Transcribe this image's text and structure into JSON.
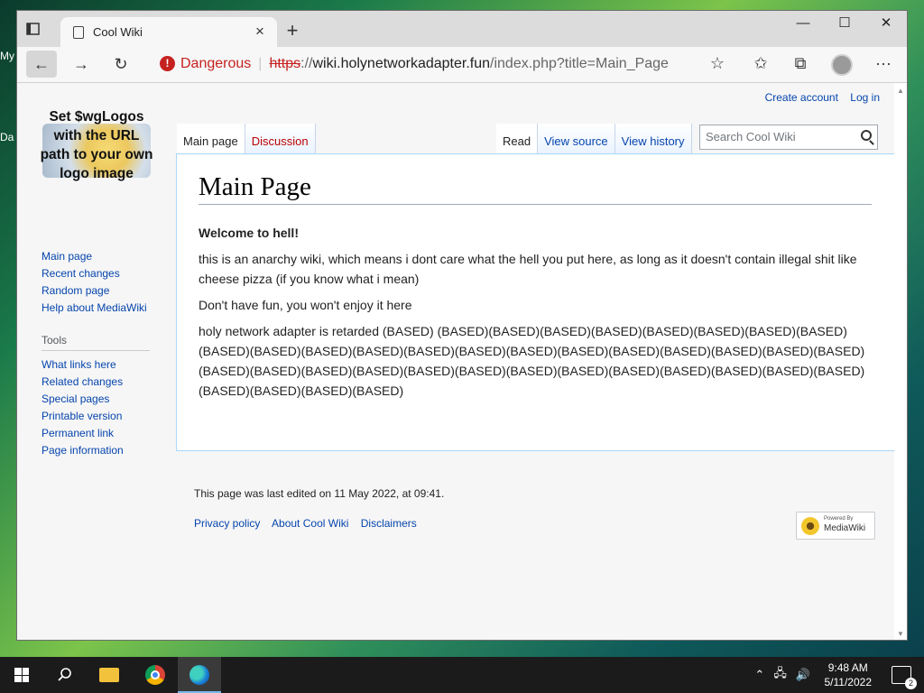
{
  "desktop": {
    "icon_labels": [
      "My",
      "Da"
    ]
  },
  "browser": {
    "tab_title": "Cool Wiki",
    "tab_close": "×",
    "new_tab": "+",
    "window_controls": {
      "minimize": "—",
      "maximize": "☐",
      "close": "✕"
    },
    "nav": {
      "back": "←",
      "forward": "→",
      "reload": "↻"
    },
    "address": {
      "security_label": "Dangerous",
      "scheme": "https",
      "separator": "://",
      "host": "wiki.holynetworkadapter.fun",
      "path": "/index.php?title=Main_Page"
    },
    "toolbar_icons": [
      "add-favorite-icon",
      "favorites-icon",
      "collections-icon",
      "profile-avatar",
      "more-icon"
    ],
    "more_label": "···"
  },
  "wiki": {
    "personal": {
      "create_account": "Create account",
      "log_in": "Log in"
    },
    "logo_text": "Set $wgLogos with the URL path to your own logo image",
    "tabs_left": [
      {
        "label": "Main page",
        "selected": true
      },
      {
        "label": "Discussion",
        "selected": false,
        "new": true
      }
    ],
    "tabs_right": [
      {
        "label": "Read",
        "selected": true
      },
      {
        "label": "View source",
        "selected": false
      },
      {
        "label": "View history",
        "selected": false
      }
    ],
    "search_placeholder": "Search Cool Wiki",
    "navigation": [
      "Main page",
      "Recent changes",
      "Random page",
      "Help about MediaWiki"
    ],
    "tools_heading": "Tools",
    "tools": [
      "What links here",
      "Related changes",
      "Special pages",
      "Printable version",
      "Permanent link",
      "Page information"
    ],
    "heading": "Main Page",
    "paragraphs": [
      "Welcome to hell!",
      "this is an anarchy wiki, which means i dont care what the hell you put here, as long as it doesn't contain illegal shit like cheese pizza (if you know what i mean)",
      "Don't have fun, you won't enjoy it here",
      "holy network adapter is retarded (BASED) (BASED)(BASED)(BASED)(BASED)(BASED)(BASED)(BASED)(BASED)(BASED)(BASED)(BASED)(BASED)(BASED)(BASED)(BASED)(BASED)(BASED)(BASED)(BASED)(BASED)(BASED)(BASED)(BASED)(BASED)(BASED)(BASED)(BASED)(BASED)(BASED)(BASED)(BASED)(BASED)(BASED)(BASED)(BASED)(BASED)(BASED)(BASED)"
    ],
    "footer": {
      "last_edited": "This page was last edited on 11 May 2022, at 09:41.",
      "links": [
        "Privacy policy",
        "About Cool Wiki",
        "Disclaimers"
      ],
      "powered_small": "Powered By",
      "powered_big": "MediaWiki"
    }
  },
  "taskbar": {
    "time": "9:48 AM",
    "date": "5/11/2022",
    "notifications": "2",
    "tray_icons": [
      "chevron-up-icon",
      "network-icon",
      "volume-icon"
    ]
  }
}
